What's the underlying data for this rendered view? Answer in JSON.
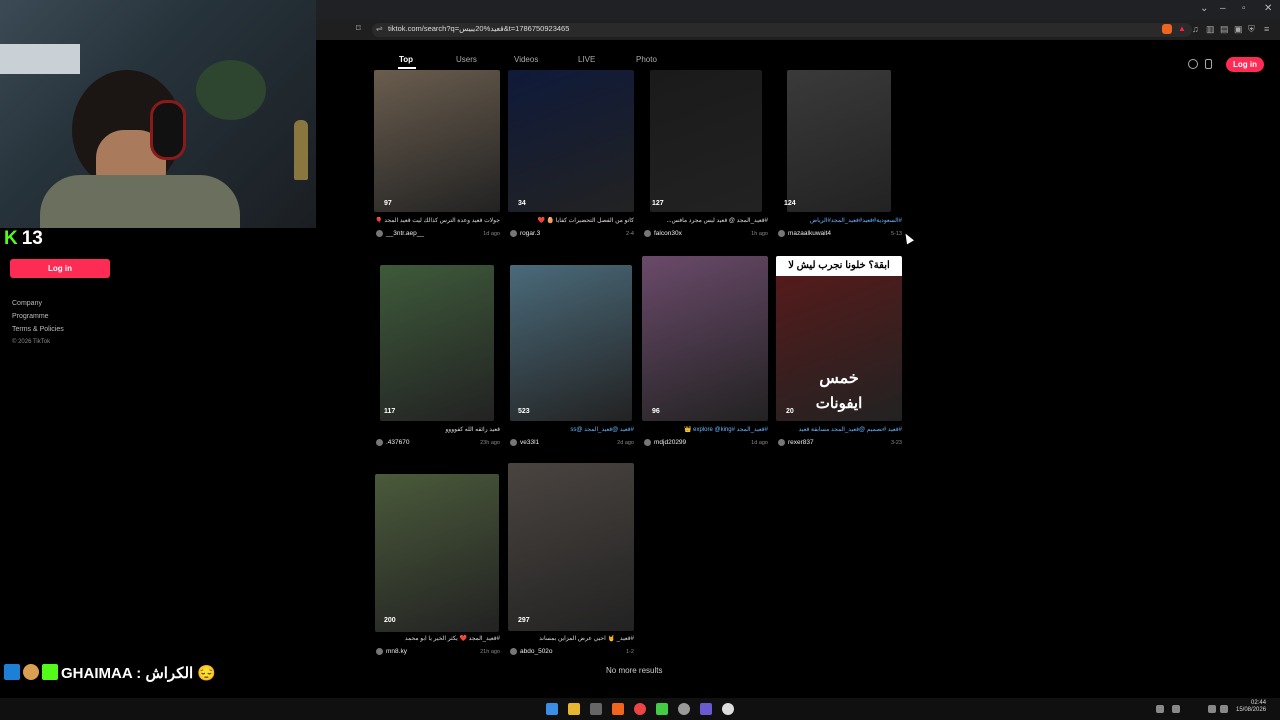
{
  "browser": {
    "url": "tiktok.com/search?q=قعيد%20يبيس&t=1786750923465"
  },
  "stream": {
    "platform_icon": "kick-logo",
    "viewer_count": "13",
    "chat_line": "GHAIMAA : الكراش 😔"
  },
  "sidebar": {
    "login_label": "Log in",
    "links": [
      "Company",
      "Programme",
      "Terms & Policies"
    ],
    "copyright": "© 2026 TikTok"
  },
  "tabs": [
    "Top",
    "Users",
    "Videos",
    "LIVE",
    "Photo"
  ],
  "header": {
    "login_label": "Log in"
  },
  "videos": [
    {
      "likes": "97",
      "caption": "جولات قعيد وعدة الترس كذالك ليت قعيد المجد 🎈",
      "user": "__3ntr.aep__",
      "time": "1d ago",
      "color": "#6a5d4e"
    },
    {
      "likes": "34",
      "caption": "كاتو من الفصل التحضيرات كفاياً 🥚 ❤️",
      "user": "rogar.3",
      "time": "2-4",
      "color": "#0f1a3a"
    },
    {
      "likes": "127",
      "caption": "#قعيد_المجد @ قعيد ليس مجرد مافس...",
      "user": "falcon30x",
      "time": "1h ago",
      "color": "#1a1a1a"
    },
    {
      "likes": "124",
      "caption": "#السعودية#قعيد#قعيد_المجد#الرياض",
      "user": "mazaalkuwait4",
      "time": "5-13",
      "color": "#3a3a3a"
    },
    {
      "likes": "117",
      "caption": "قعيد رائقه الله كفوووو",
      "user": ".437670",
      "time": "23h ago",
      "color": "#3e5a3a"
    },
    {
      "likes": "523",
      "caption": "#قعيد @قعيد_المجد @ss",
      "user": "ve33l1",
      "time": "2d ago",
      "color": "#4a6a7a"
    },
    {
      "likes": "96",
      "caption": "#قعيد_المجد #explore @king 👑",
      "user": "mdjd20299",
      "time": "1d ago",
      "color": "#6a4a6a"
    },
    {
      "likes": "20",
      "caption": "#قعيد #تصميم @قعيد_المجد مسابقة قعيد",
      "user": "rexer837",
      "time": "3-23",
      "color": "#5a1a1a"
    },
    {
      "likes": "200",
      "caption": "#قعيد_المجد ❤️ يكثر الخير يا ابو محمد",
      "user": "mn8.ky",
      "time": "21h ago",
      "color": "#4a5a3a"
    },
    {
      "likes": "297",
      "caption": "#قعيد_ 🤘 احيي عرض المزاين بمساند",
      "user": "abdo_502o",
      "time": "1-2",
      "color": "#4a4440"
    }
  ],
  "overlays": {
    "card8_top": "ابقة؟ خلونا نجرب ليش لا",
    "card8_bottom1": "خمس",
    "card8_bottom2": "ايفونات"
  },
  "footer": {
    "no_more": "No more results"
  },
  "clock": {
    "time": "02:44",
    "date": "15/08/2026"
  }
}
